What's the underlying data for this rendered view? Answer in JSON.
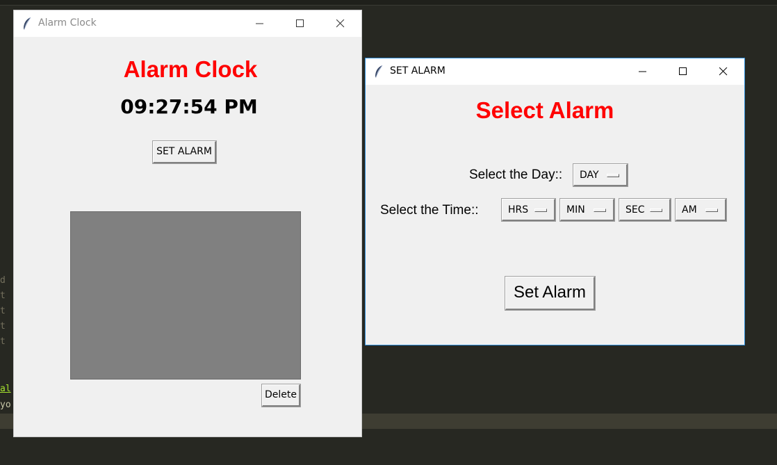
{
  "editor": {
    "gutter": [
      "d",
      "t",
      "t",
      "t",
      "t"
    ],
    "code_lines": [
      "al",
      "yo"
    ]
  },
  "main_window": {
    "title": "Alarm Clock",
    "heading": "Alarm Clock",
    "time": "09:27:54 PM",
    "set_alarm_button": "SET ALARM",
    "delete_button": "Delete",
    "alarm_list": []
  },
  "set_window": {
    "title": "SET ALARM",
    "heading": "Select Alarm",
    "day_label": "Select the Day::",
    "day_menu": "DAY",
    "time_label": "Select the Time::",
    "hours_menu": "HRS",
    "minutes_menu": "MIN",
    "seconds_menu": "SEC",
    "ampm_menu": "AM",
    "set_button": "Set Alarm"
  },
  "colors": {
    "heading_red": "#ff0000",
    "listbox_gray": "#808080",
    "active_border": "#2b8bd6"
  },
  "icons": {
    "app_icon": "feather-icon",
    "minimize": "minimize-icon",
    "maximize": "maximize-icon",
    "close": "close-icon"
  }
}
